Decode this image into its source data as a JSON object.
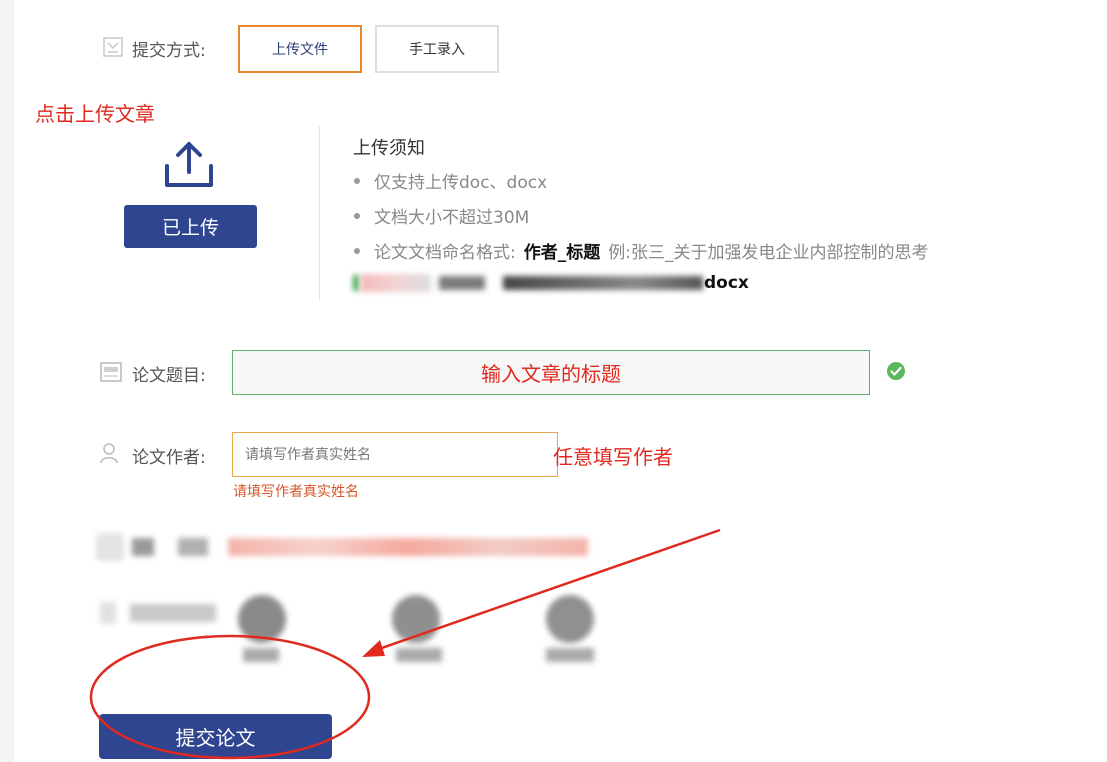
{
  "submit_method": {
    "label": "提交方式:",
    "options": [
      "上传文件",
      "手工录入"
    ],
    "selected": "上传文件"
  },
  "annotations": {
    "upload_hint": "点击上传文章",
    "title_hint": "输入文章的标题",
    "author_hint": "任意填写作者"
  },
  "upload": {
    "button_label": "已上传",
    "file_name_suffix": "docx"
  },
  "notice": {
    "title": "上传须知",
    "item1": "仅支持上传doc、docx",
    "item2": "文档大小不超过30M",
    "item3_prefix": "论文文档命名格式:",
    "item3_bold": "作者_标题",
    "item3_suffix": "例:张三_关于加强发电企业内部控制的思考"
  },
  "form": {
    "title_label": "论文题目:",
    "author_label": "论文作者:",
    "author_placeholder": "请填写作者真实姓名",
    "author_error": "请填写作者真实姓名"
  },
  "submit": {
    "label": "提交论文"
  },
  "colors": {
    "primary": "#2f4590",
    "active_border": "#e8872d",
    "annotation_red": "#e02a1f",
    "valid_green": "#61b06b"
  }
}
